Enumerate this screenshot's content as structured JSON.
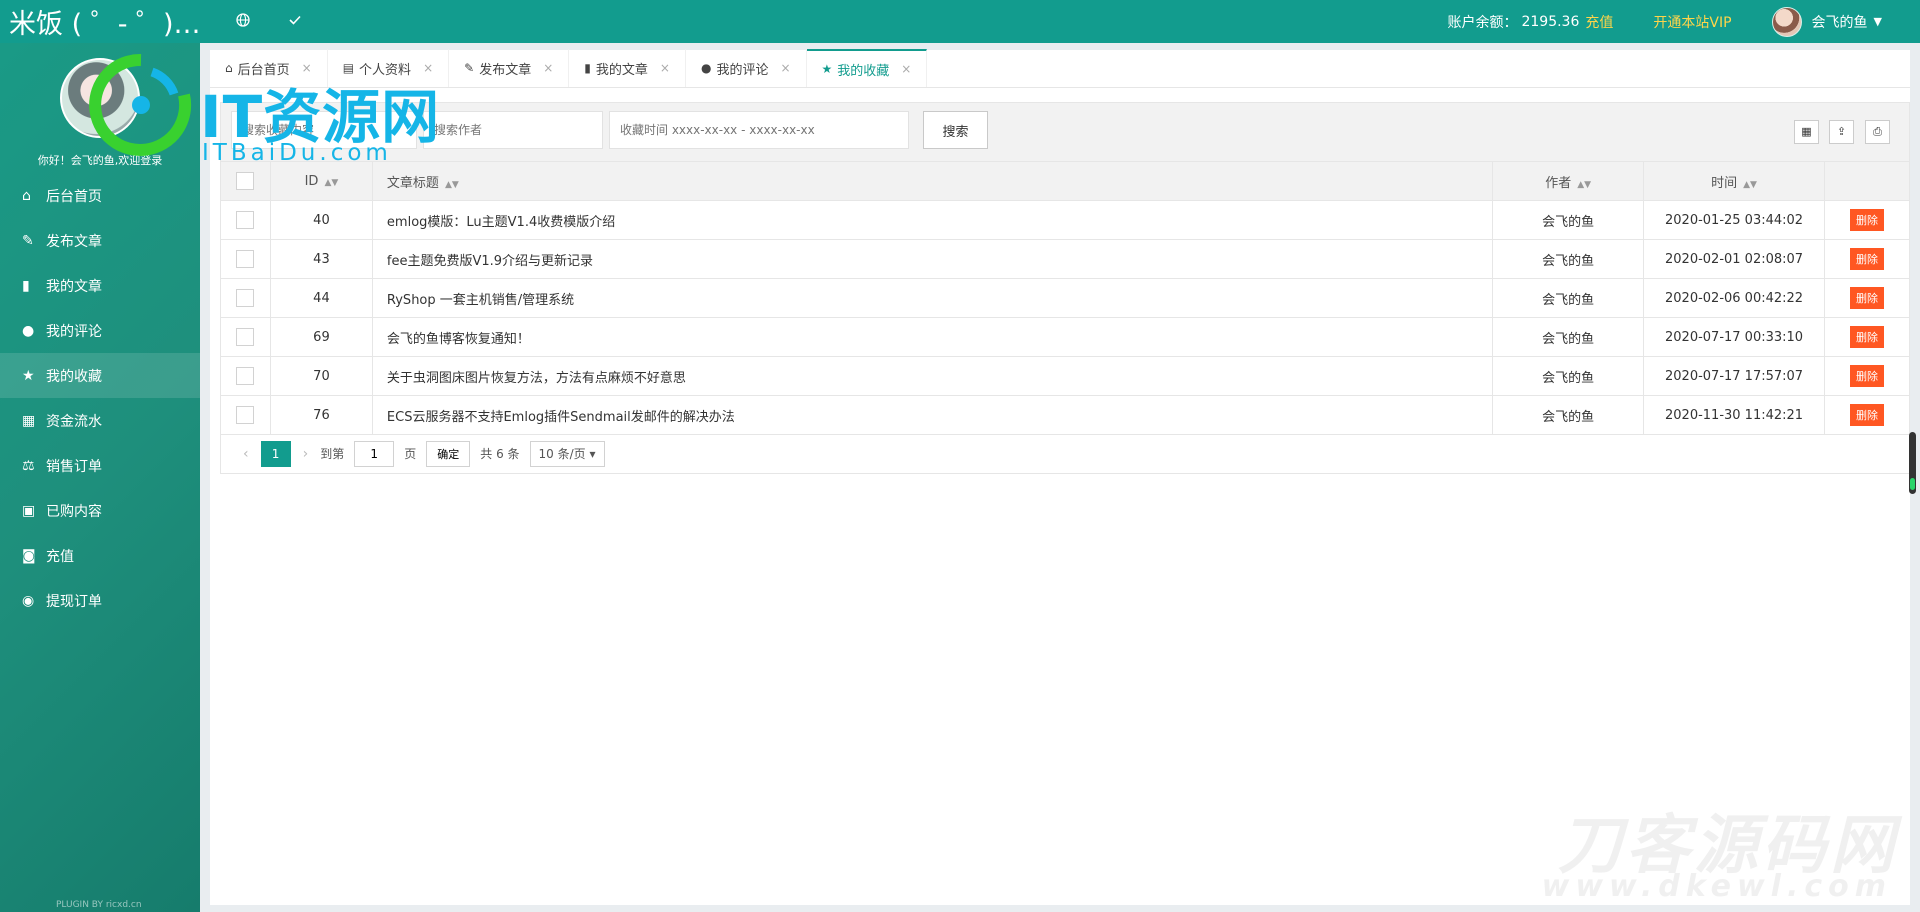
{
  "topbar": {
    "brand": "米饭 ( ゜- ゜)…",
    "icons": [
      "globe-icon",
      "check-icon"
    ],
    "balance_label": "账户余额：",
    "balance_value": "2195.36",
    "recharge": "充值",
    "vip": "开通本站VIP",
    "username": "会飞的鱼"
  },
  "sidebar": {
    "greeting": "你好！会飞的鱼,欢迎登录",
    "items": [
      {
        "label": "后台首页",
        "icon": "home-icon"
      },
      {
        "label": "发布文章",
        "icon": "edit-icon"
      },
      {
        "label": "我的文章",
        "icon": "book-icon"
      },
      {
        "label": "我的评论",
        "icon": "comments-icon"
      },
      {
        "label": "我的收藏",
        "icon": "star-icon"
      },
      {
        "label": "资金流水",
        "icon": "calculator-icon"
      },
      {
        "label": "销售订单",
        "icon": "balance-icon"
      },
      {
        "label": "已购内容",
        "icon": "lock-icon"
      },
      {
        "label": "充值",
        "icon": "bag-icon"
      },
      {
        "label": "提现订单",
        "icon": "user-circle-icon"
      }
    ],
    "active_index": 4,
    "plugin_by": "PLUGIN BY ricxd.cn"
  },
  "tabs": [
    {
      "label": "后台首页",
      "icon": "home-icon"
    },
    {
      "label": "个人资料",
      "icon": "id-card-icon"
    },
    {
      "label": "发布文章",
      "icon": "edit-icon"
    },
    {
      "label": "我的文章",
      "icon": "book-icon"
    },
    {
      "label": "我的评论",
      "icon": "comments-icon"
    },
    {
      "label": "我的收藏",
      "icon": "star-icon"
    }
  ],
  "active_tab": 5,
  "search": {
    "content_placeholder": "搜索收藏内容",
    "author_placeholder": "搜索作者",
    "date_placeholder": "收藏时间 xxxx-xx-xx - xxxx-xx-xx",
    "button": "搜索"
  },
  "toolbar_icons": [
    "columns-icon",
    "export-icon",
    "print-icon"
  ],
  "table": {
    "headers": {
      "id": "ID",
      "title": "文章标题",
      "author": "作者",
      "time": "时间"
    },
    "rows": [
      {
        "id": "40",
        "title": "emlog模版：Lu主题V1.4收费模版介绍",
        "author": "会飞的鱼",
        "time": "2020-01-25 03:44:02",
        "action": "删除"
      },
      {
        "id": "43",
        "title": "fee主题免费版V1.9介绍与更新记录",
        "author": "会飞的鱼",
        "time": "2020-02-01 02:08:07",
        "action": "删除"
      },
      {
        "id": "44",
        "title": "RyShop 一套主机销售/管理系统",
        "author": "会飞的鱼",
        "time": "2020-02-06 00:42:22",
        "action": "删除"
      },
      {
        "id": "69",
        "title": "会飞的鱼博客恢复通知！",
        "author": "会飞的鱼",
        "time": "2020-07-17 00:33:10",
        "action": "删除"
      },
      {
        "id": "70",
        "title": "关于虫洞图床图片恢复方法，方法有点麻烦不好意思",
        "author": "会飞的鱼",
        "time": "2020-07-17 17:57:07",
        "action": "删除"
      },
      {
        "id": "76",
        "title": "ECS云服务器不支持Emlog插件Sendmail发邮件的解决办法",
        "author": "会飞的鱼",
        "time": "2020-11-30 11:42:21",
        "action": "删除"
      }
    ]
  },
  "pager": {
    "current": "1",
    "goto_label": "到第",
    "goto_value": "1",
    "page_label": "页",
    "confirm": "确定",
    "total": "共 6 条",
    "per_page": "10 条/页"
  },
  "watermarks": {
    "logo_big": "IT资源网",
    "logo_small": "ITBaiDu.com",
    "bottom_big": "刀客源码网",
    "bottom_small": "www.dkewl.com"
  },
  "colors": {
    "primary": "#129c8e",
    "accent": "#ffd54a",
    "danger": "#ff5722"
  }
}
